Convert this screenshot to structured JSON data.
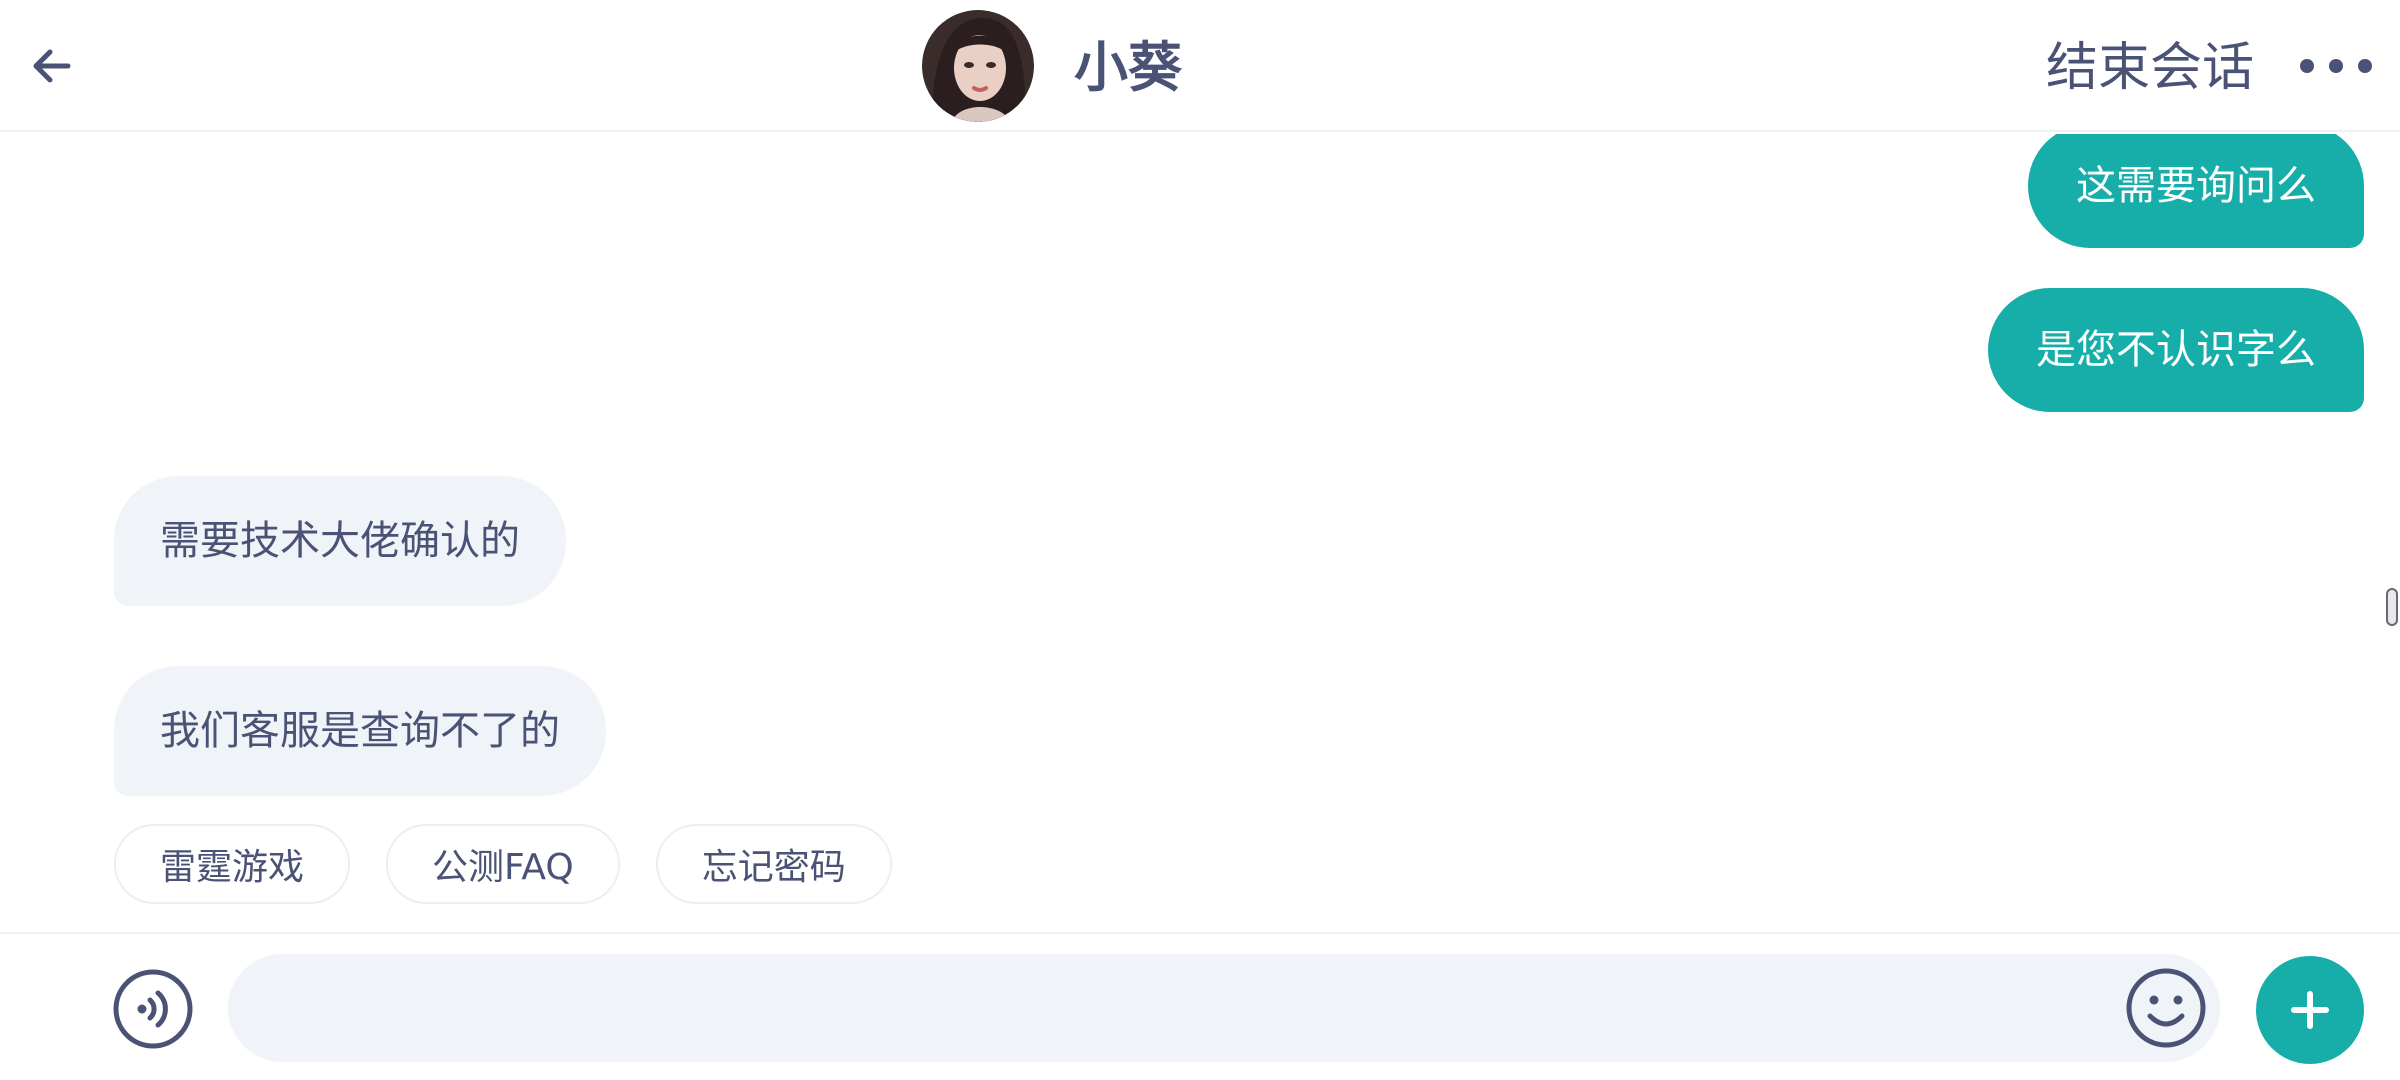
{
  "header": {
    "title": "小葵",
    "end_label": "结束会话",
    "back_icon": "arrow-left-icon",
    "more_icon": "more-horizontal-icon"
  },
  "messages": [
    {
      "side": "out",
      "text": "这需要询问么"
    },
    {
      "side": "out",
      "text": "是您不认识字么"
    },
    {
      "side": "in",
      "text": "需要技术大佬确认的"
    },
    {
      "side": "in",
      "text": "我们客服是查询不了的"
    }
  ],
  "quick_replies": [
    "雷霆游戏",
    "公测FAQ",
    "忘记密码"
  ],
  "input": {
    "value": "",
    "placeholder": "",
    "voice_icon": "voice-icon",
    "emoji_icon": "emoji-icon",
    "plus_icon": "plus-icon"
  },
  "colors": {
    "accent": "#17aeaa",
    "text": "#4a5275",
    "incoming_bubble": "#f0f3f7"
  }
}
